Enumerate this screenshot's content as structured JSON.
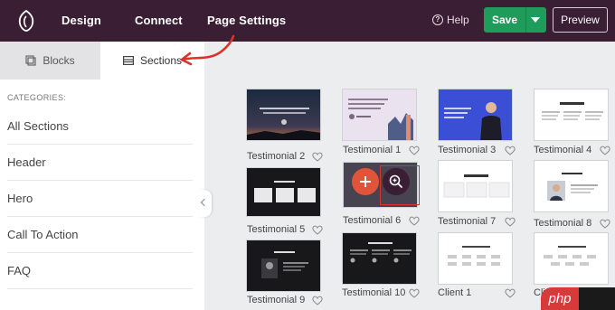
{
  "topbar": {
    "nav": [
      "Design",
      "Connect",
      "Page Settings"
    ],
    "help_label": "Help",
    "save_label": "Save",
    "preview_label": "Preview"
  },
  "sidebar": {
    "tabs": [
      "Blocks",
      "Sections"
    ],
    "categories_heading": "CATEGORIES:",
    "categories": [
      "All Sections",
      "Header",
      "Hero",
      "Call To Action",
      "FAQ"
    ]
  },
  "sections": [
    {
      "label": "Testimonial 2"
    },
    {
      "label": "Testimonial 1"
    },
    {
      "label": "Testimonial 3"
    },
    {
      "label": "Testimonial 4"
    },
    {
      "label": "Testimonial 5"
    },
    {
      "label": "Testimonial 6"
    },
    {
      "label": "Testimonial 7"
    },
    {
      "label": "Testimonial 8"
    },
    {
      "label": "Testimonial 9"
    },
    {
      "label": "Testimonial 10"
    },
    {
      "label": "Client 1"
    },
    {
      "label": "Client 2"
    }
  ],
  "watermark": "php",
  "colors": {
    "topbar": "#3a1e33",
    "save": "#1f9c5b",
    "add": "#e0543a",
    "highlight": "#d8342a"
  }
}
